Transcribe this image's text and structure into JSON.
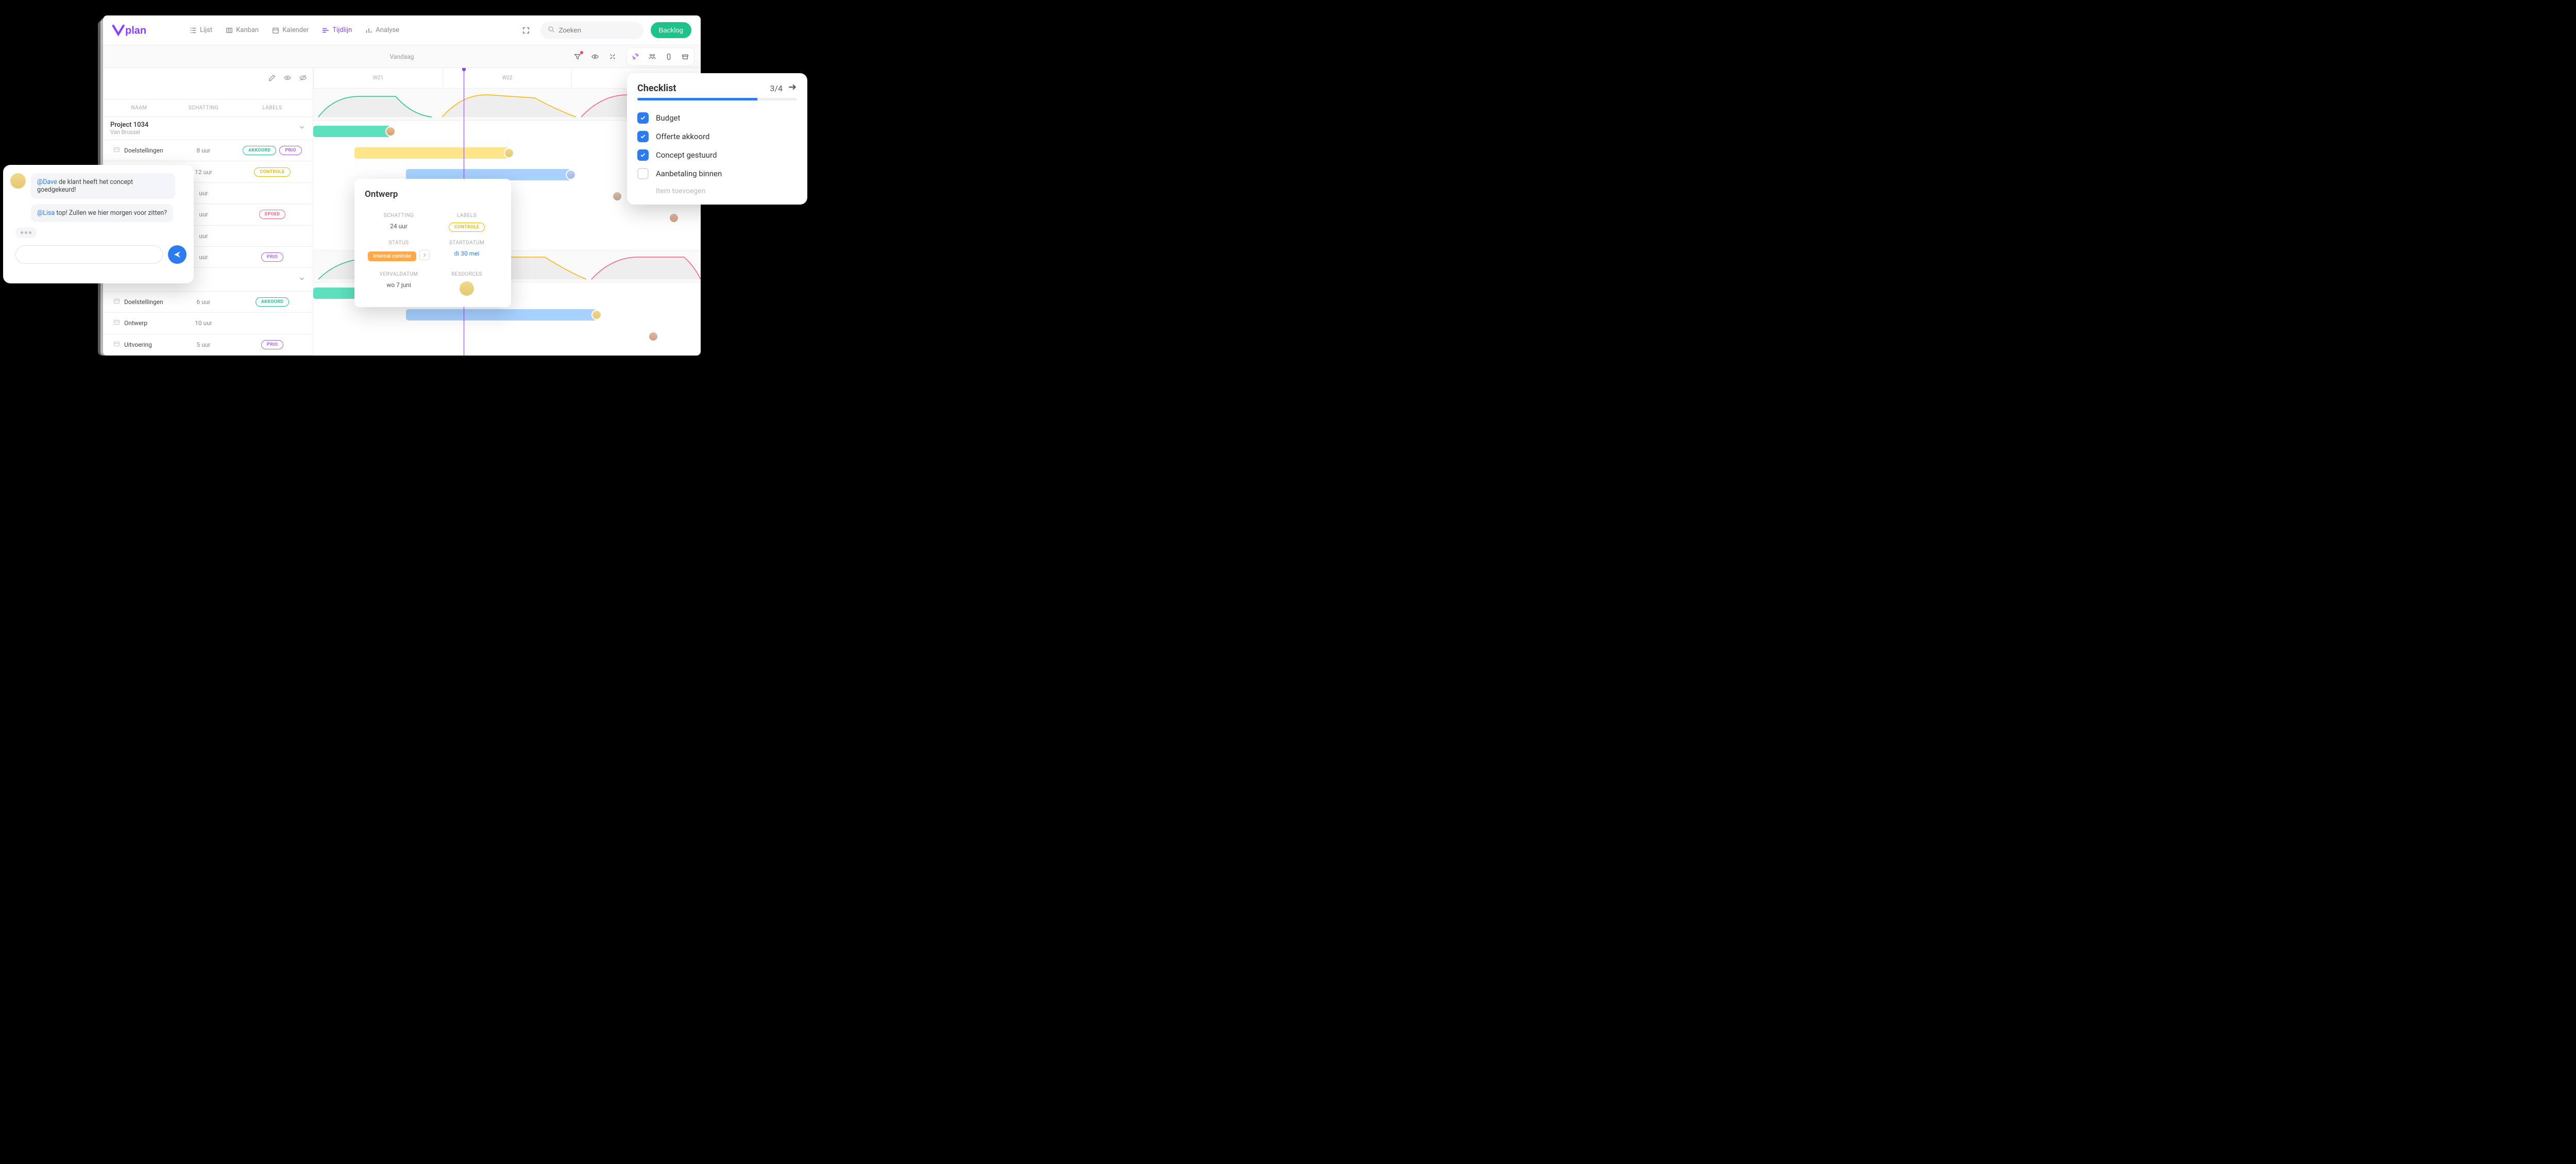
{
  "header": {
    "logo_text": "plan",
    "nav": [
      {
        "label": "Lijst",
        "icon": "list-icon"
      },
      {
        "label": "Kanban",
        "icon": "board-icon"
      },
      {
        "label": "Kalender",
        "icon": "calendar-icon"
      },
      {
        "label": "Tijdlijn",
        "icon": "timeline-icon",
        "active": true
      },
      {
        "label": "Analyse",
        "icon": "chart-icon"
      }
    ],
    "search_placeholder": "Zoeken",
    "backlog_label": "Backlog"
  },
  "toolbar": {
    "today_label": "Vandaag"
  },
  "columns": {
    "name": "NAAM",
    "estimate": "SCHATTING",
    "labels": "LABELS"
  },
  "weeks": [
    "W21",
    "W22"
  ],
  "groups": [
    {
      "name": "Project 1034",
      "subtitle": "Van Brussel",
      "tasks": [
        {
          "name": "Doelstellingen",
          "est": "8 uur",
          "labels": [
            "AKKOORD",
            "PRIO"
          ]
        },
        {
          "name": "",
          "est": "12 uur",
          "labels": [
            "CONTROLE"
          ]
        },
        {
          "name": "",
          "est": "uur",
          "labels": []
        },
        {
          "name": "",
          "est": "uur",
          "labels": [
            "SPOED"
          ]
        },
        {
          "name": "",
          "est": "uur",
          "labels": []
        },
        {
          "name": "",
          "est": "uur",
          "labels": [
            "PRIO"
          ]
        }
      ]
    },
    {
      "name": "",
      "subtitle": "",
      "tasks": [
        {
          "name": "Doelstellingen",
          "est": "6 uur",
          "labels": [
            "AKKOORD"
          ]
        },
        {
          "name": "Ontwerp",
          "est": "10 uur",
          "labels": []
        },
        {
          "name": "Uitvoering",
          "est": "5 uur",
          "labels": [
            "PRIO"
          ]
        }
      ]
    }
  ],
  "popover": {
    "title": "Ontwerp",
    "estimate_label": "SCHATTING",
    "estimate_value": "24 uur",
    "labels_label": "LABELS",
    "label_pill": "CONTROLE",
    "status_label": "STATUS",
    "status_value": "Internal controle",
    "start_label": "STARTDATUM",
    "start_value": "di 30 mei",
    "due_label": "VERVALDATUM",
    "due_value": "wo 7 juni",
    "resources_label": "RESOURCES"
  },
  "chat": {
    "msg1_mention": "@Dave",
    "msg1_text": " de klant heeft het concept goedgekeurd!",
    "msg2_mention": "@Lisa",
    "msg2_text": " top! Zullen we hier morgen voor zitten?"
  },
  "checklist": {
    "title": "Checklist",
    "count": "3/4",
    "items": [
      {
        "label": "Budget",
        "checked": true
      },
      {
        "label": "Offerte akkoord",
        "checked": true
      },
      {
        "label": "Concept gestuurd",
        "checked": true
      },
      {
        "label": "Aanbetaling binnen",
        "checked": false
      }
    ],
    "add_placeholder": "Item toevoegen",
    "progress_percent": 75
  }
}
